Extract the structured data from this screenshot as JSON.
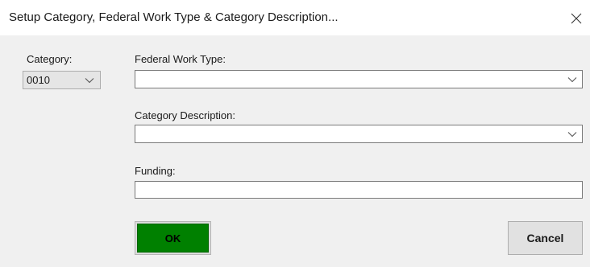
{
  "window": {
    "title": "Setup Category, Federal Work Type & Category Description..."
  },
  "category": {
    "label": "Category:",
    "selected": "0010"
  },
  "federal_work_type": {
    "label": "Federal Work Type:",
    "value": ""
  },
  "category_description": {
    "label": "Category Description:",
    "value": ""
  },
  "funding": {
    "label": "Funding:",
    "value": ""
  },
  "buttons": {
    "ok": "OK",
    "cancel": "Cancel"
  },
  "colors": {
    "ok_fill": "#008000",
    "dialog_bg": "#f0f0f0",
    "titlebar_bg": "#ffffff"
  },
  "icons": {
    "close": "close-icon",
    "dropdown": "chevron-down-icon"
  }
}
